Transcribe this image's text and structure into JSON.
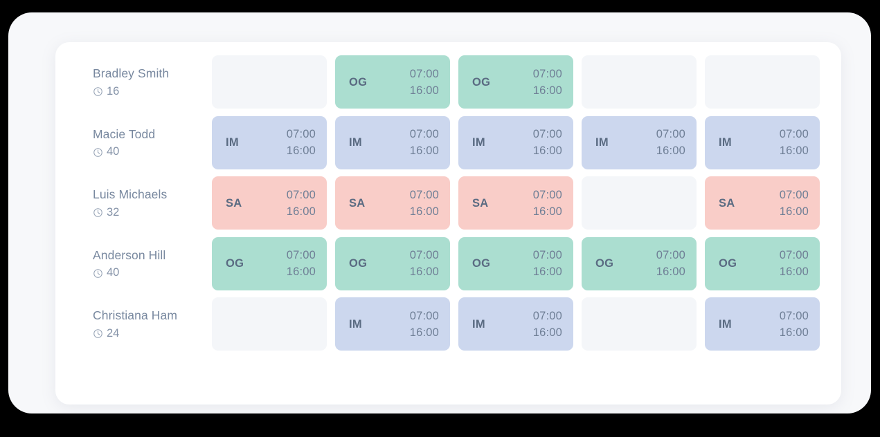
{
  "theme": {
    "page_background": "#000000",
    "frame_background": "#f7f8fa",
    "card_background": "#ffffff",
    "empty_cell": "#f4f6f9",
    "name_text": "#78889f",
    "code_text": "#5a6b82",
    "time_text": "#6f7f96",
    "shift_colors": {
      "OG": "#abded0",
      "IM": "#ccd7ee",
      "SA": "#f9cdc8"
    }
  },
  "icons": {
    "clock": "clock-icon"
  },
  "schedule": {
    "columns": 5,
    "rows": [
      {
        "employee": "Bradley Smith",
        "hours": "16",
        "shifts": [
          {
            "code": "",
            "start": "",
            "end": "",
            "empty": true
          },
          {
            "code": "OG",
            "start": "07:00",
            "end": "16:00",
            "empty": false
          },
          {
            "code": "OG",
            "start": "07:00",
            "end": "16:00",
            "empty": false
          },
          {
            "code": "",
            "start": "",
            "end": "",
            "empty": true
          },
          {
            "code": "",
            "start": "",
            "end": "",
            "empty": true
          }
        ]
      },
      {
        "employee": "Macie Todd",
        "hours": "40",
        "shifts": [
          {
            "code": "IM",
            "start": "07:00",
            "end": "16:00",
            "empty": false
          },
          {
            "code": "IM",
            "start": "07:00",
            "end": "16:00",
            "empty": false
          },
          {
            "code": "IM",
            "start": "07:00",
            "end": "16:00",
            "empty": false
          },
          {
            "code": "IM",
            "start": "07:00",
            "end": "16:00",
            "empty": false
          },
          {
            "code": "IM",
            "start": "07:00",
            "end": "16:00",
            "empty": false
          }
        ]
      },
      {
        "employee": "Luis Michaels",
        "hours": "32",
        "shifts": [
          {
            "code": "SA",
            "start": "07:00",
            "end": "16:00",
            "empty": false
          },
          {
            "code": "SA",
            "start": "07:00",
            "end": "16:00",
            "empty": false
          },
          {
            "code": "SA",
            "start": "07:00",
            "end": "16:00",
            "empty": false
          },
          {
            "code": "",
            "start": "",
            "end": "",
            "empty": true
          },
          {
            "code": "SA",
            "start": "07:00",
            "end": "16:00",
            "empty": false
          }
        ]
      },
      {
        "employee": "Anderson Hill",
        "hours": "40",
        "shifts": [
          {
            "code": "OG",
            "start": "07:00",
            "end": "16:00",
            "empty": false
          },
          {
            "code": "OG",
            "start": "07:00",
            "end": "16:00",
            "empty": false
          },
          {
            "code": "OG",
            "start": "07:00",
            "end": "16:00",
            "empty": false
          },
          {
            "code": "OG",
            "start": "07:00",
            "end": "16:00",
            "empty": false
          },
          {
            "code": "OG",
            "start": "07:00",
            "end": "16:00",
            "empty": false
          }
        ]
      },
      {
        "employee": "Christiana Ham",
        "hours": "24",
        "shifts": [
          {
            "code": "",
            "start": "",
            "end": "",
            "empty": true
          },
          {
            "code": "IM",
            "start": "07:00",
            "end": "16:00",
            "empty": false
          },
          {
            "code": "IM",
            "start": "07:00",
            "end": "16:00",
            "empty": false
          },
          {
            "code": "",
            "start": "",
            "end": "",
            "empty": true
          },
          {
            "code": "IM",
            "start": "07:00",
            "end": "16:00",
            "empty": false
          }
        ]
      }
    ]
  }
}
